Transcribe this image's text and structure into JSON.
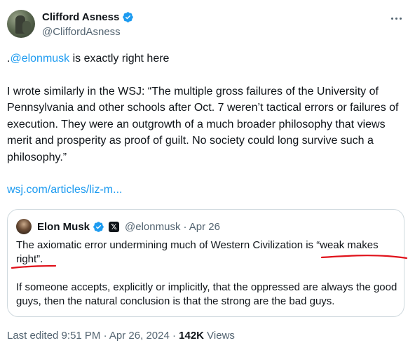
{
  "tweet": {
    "author_name": "Clifford Asness",
    "author_handle": "@CliffordAsness",
    "mention_prefix": ".",
    "mention": "@elonmusk",
    "mention_suffix": " is exactly right here",
    "paragraph": "I wrote similarly in the WSJ: “The multiple gross failures of the University of Pennsylvania and other schools after Oct. 7 weren’t tactical errors or failures of execution. They were an outgrowth of a much broader philosophy that views merit and prosperity as proof of guilt. No society could long survive such a philosophy.”",
    "link_text": "wsj.com/articles/liz-m...",
    "edited_label": "Last edited 9:51 PM · Apr 26, 2024 · ",
    "views_count": "142K",
    "views_label": " Views"
  },
  "quote": {
    "author_name": "Elon Musk",
    "affiliate_badge": "𝕏",
    "author_handle": "@elonmusk",
    "date": " · Apr 26",
    "line1": "The axiomatic error undermining much of Western Civilization is “weak makes right”.",
    "line2": "If someone accepts, explicitly or implicitly, that the oppressed are always the good guys, then the natural conclusion is that the strong are the bad guys."
  },
  "colors": {
    "link": "#1d9bf0",
    "verified": "#1d9bf0",
    "muted": "#536471",
    "annotation": "#e0121b"
  },
  "icons": [
    "verified-badge-icon",
    "more-options-icon",
    "x-affiliate-icon"
  ]
}
